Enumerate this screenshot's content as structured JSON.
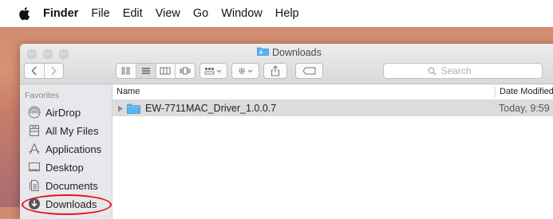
{
  "menubar": {
    "app_name": "Finder",
    "items": [
      "File",
      "Edit",
      "View",
      "Go",
      "Window",
      "Help"
    ]
  },
  "window": {
    "title": "Downloads",
    "search_placeholder": "Search"
  },
  "sidebar": {
    "section": "Favorites",
    "items": [
      {
        "label": "AirDrop",
        "icon": "airdrop-icon"
      },
      {
        "label": "All My Files",
        "icon": "all-my-files-icon"
      },
      {
        "label": "Applications",
        "icon": "applications-icon"
      },
      {
        "label": "Desktop",
        "icon": "desktop-icon"
      },
      {
        "label": "Documents",
        "icon": "documents-icon"
      },
      {
        "label": "Downloads",
        "icon": "downloads-icon",
        "highlighted": true
      }
    ]
  },
  "list": {
    "columns": [
      "Name",
      "Date Modified"
    ],
    "rows": [
      {
        "name": "EW-7711MAC_Driver_1.0.0.7",
        "date": "Today, 9:59"
      }
    ]
  },
  "colors": {
    "highlight_oval": "#e0161d",
    "folder": "#5ab4f0",
    "row_selected": "#dcdcdc"
  }
}
